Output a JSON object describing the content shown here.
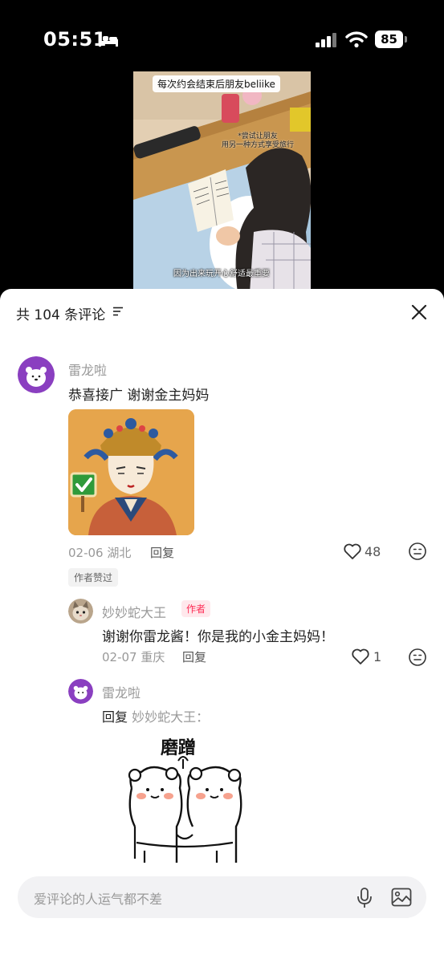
{
  "status_bar": {
    "time": "05:51",
    "battery": "85",
    "icons": [
      "bed-icon",
      "signal-icon",
      "wifi-icon",
      "battery-icon"
    ]
  },
  "video": {
    "title": "每次约会结束后朋友beliike",
    "caption_line1": "*尝试让朋友",
    "caption_line2": "用另一种方式享受旅行",
    "subtitle": "因为出来玩开心舒适最重要"
  },
  "comments_sheet": {
    "title": "共 104 条评论",
    "sort_icon": "filter-icon",
    "close_icon": "close-icon"
  },
  "comments": [
    {
      "username": "雷龙啦",
      "text": "恭喜接广 谢谢金主妈妈",
      "date": "02-06",
      "location": "湖北",
      "reply_label": "回复",
      "likes": "48",
      "badge": "作者赞过",
      "sticker": "empress-approval-sticker"
    }
  ],
  "replies": [
    {
      "username": "妙妙蛇大王",
      "badge": "作者",
      "text": "谢谢你雷龙酱！你是我的小金主妈妈！",
      "date": "02-07",
      "location": "重庆",
      "reply_label": "回复",
      "likes": "1"
    },
    {
      "username": "雷龙啦",
      "reply_prefix": "回复",
      "reply_to": "妙妙蛇大王：",
      "sticker_text": "磨蹭",
      "sticker": "hugging-bears-sticker"
    }
  ],
  "input": {
    "placeholder": "爱评论的人运气都不差",
    "icons": [
      "mic-icon",
      "image-icon"
    ]
  },
  "colors": {
    "accent_red": "#fe2c55",
    "avatar_purple": "#8a3fc0",
    "text_gray": "#999999"
  }
}
